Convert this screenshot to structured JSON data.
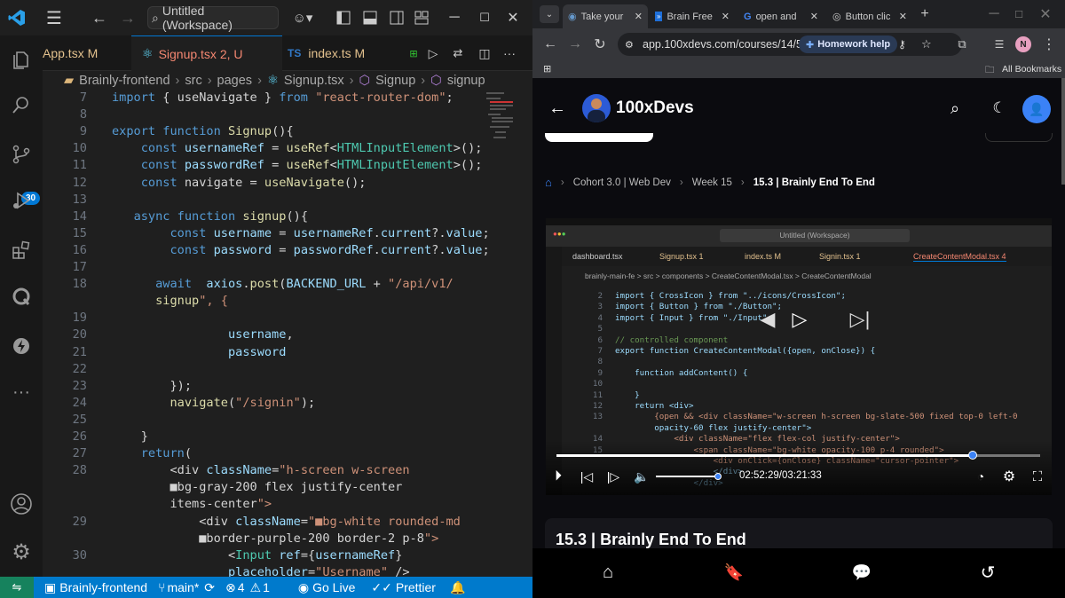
{
  "vscode": {
    "search": "Untitled (Workspace)",
    "tabs": [
      {
        "name": "App.tsx",
        "status": "M",
        "prefix": ""
      },
      {
        "name": "Signup.tsx",
        "status": "2, U",
        "prefix": "⚛"
      },
      {
        "name": "index.ts",
        "status": "M",
        "prefix": "TS"
      }
    ],
    "breadcrumb": [
      "Brainly-frontend",
      "src",
      "pages",
      "Signup.tsx",
      "Signup",
      "signup"
    ],
    "badge": "30",
    "status": {
      "project": "Brainly-frontend",
      "branch": "main*",
      "errors": "4",
      "warnings": "1",
      "golive": "Go Live",
      "prettier": "Prettier"
    }
  },
  "code": {
    "lines": [
      {
        "n": "7",
        "t": "import { useNavigate } from \"react-router-dom\";"
      },
      {
        "n": "8",
        "t": ""
      },
      {
        "n": "9",
        "t": "export function Signup(){"
      },
      {
        "n": "10",
        "t": "    const usernameRef = useRef<HTMLInputElement>();"
      },
      {
        "n": "11",
        "t": "    const passwordRef = useRef<HTMLInputElement>();"
      },
      {
        "n": "12",
        "t": "    const navigate = useNavigate();"
      },
      {
        "n": "13",
        "t": ""
      },
      {
        "n": "14",
        "t": "   async function signup(){"
      },
      {
        "n": "15",
        "t": "        const username = usernameRef.current?.value;"
      },
      {
        "n": "16",
        "t": "        const password = passwordRef.current?.value;"
      },
      {
        "n": "17",
        "t": ""
      },
      {
        "n": "18",
        "t": "      await  axios.post(BACKEND_URL + \"/api/v1/"
      },
      {
        "n": "",
        "t": "      signup\", {"
      },
      {
        "n": "19",
        "t": ""
      },
      {
        "n": "20",
        "t": "                username,"
      },
      {
        "n": "21",
        "t": "                password"
      },
      {
        "n": "22",
        "t": ""
      },
      {
        "n": "23",
        "t": "        });"
      },
      {
        "n": "24",
        "t": "        navigate(\"/signin\");"
      },
      {
        "n": "25",
        "t": ""
      },
      {
        "n": "26",
        "t": "    }"
      },
      {
        "n": "27",
        "t": "    return("
      },
      {
        "n": "28",
        "t": "        <div className=\"h-screen w-screen"
      },
      {
        "n": "",
        "t": "        ■bg-gray-200 flex justify-center"
      },
      {
        "n": "",
        "t": "        items-center\">"
      },
      {
        "n": "29",
        "t": "            <div className=\"■bg-white rounded-md"
      },
      {
        "n": "",
        "t": "            ■border-purple-200 border-2 p-8\">"
      },
      {
        "n": "30",
        "t": "                <Input ref={usernameRef}"
      },
      {
        "n": "",
        "t": "                placeholder=\"Username\" />"
      }
    ]
  },
  "browser": {
    "tabs": [
      "Take your",
      "Brain Free",
      "open and",
      "Button clic"
    ],
    "url": "app.100xdevs.com/courses/14/5...",
    "homework": "Homework help",
    "bookmarks": "All Bookmarks",
    "brand": "100xDevs",
    "breadcrumb": [
      "Cohort 3.0 | Web Dev",
      "Week 15",
      "15.3 | Brainly End To End"
    ],
    "time": "02:52:29/03:21:33",
    "title": "15.3 | Brainly End To End",
    "video": {
      "search": "Untitled (Workspace)",
      "tabs": [
        "dashboard.tsx",
        "Signup.tsx 1",
        "index.ts M",
        "Signin.tsx 1",
        "CreateContentModal.tsx 4"
      ],
      "crumb": "brainly-main-fe > src > components > CreateContentModal.tsx > CreateContentModal",
      "lines": [
        {
          "n": "2",
          "t": "import { CrossIcon } from \"../icons/CrossIcon\";"
        },
        {
          "n": "3",
          "t": "import { Button } from \"./Button\";"
        },
        {
          "n": "4",
          "t": "import { Input } from \"./Input\";"
        },
        {
          "n": "5",
          "t": ""
        },
        {
          "n": "6",
          "t": "// controlled component"
        },
        {
          "n": "7",
          "t": "export function CreateContentModal({open, onClose}) {"
        },
        {
          "n": "8",
          "t": ""
        },
        {
          "n": "9",
          "t": "    function addContent() {"
        },
        {
          "n": "10",
          "t": ""
        },
        {
          "n": "11",
          "t": "    }"
        },
        {
          "n": "12",
          "t": "    return <div>"
        },
        {
          "n": "13",
          "t": "        {open && <div className=\"w-screen h-screen bg-slate-500 fixed top-0 left-0"
        },
        {
          "n": "",
          "t": "        opacity-60 flex justify-center\">"
        },
        {
          "n": "14",
          "t": "            <div className=\"flex flex-col justify-center\">"
        },
        {
          "n": "15",
          "t": "                <span className=\"bg-white opacity-100 p-4 rounded\">"
        },
        {
          "n": "",
          "t": "                    <div onClick={onClose} className=\"cursor-pointer\">"
        },
        {
          "n": "",
          "t": "                    </div>"
        },
        {
          "n": "",
          "t": "                </div>"
        }
      ]
    },
    "progress": 0.86,
    "volume": 1.0
  }
}
